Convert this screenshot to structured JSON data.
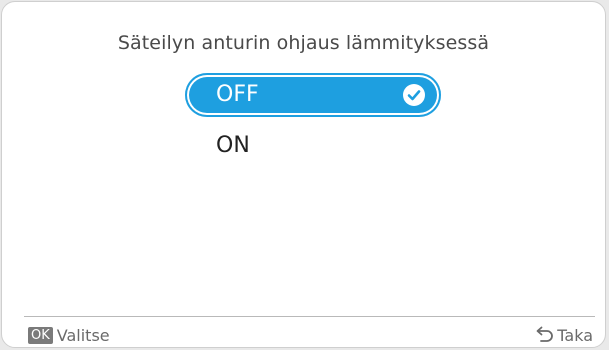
{
  "screen": {
    "title": "Säteilyn anturin ohjaus lämmityksessä"
  },
  "options": [
    {
      "label": "OFF",
      "selected": true,
      "icon": "check-circle-icon"
    },
    {
      "label": "ON",
      "selected": false
    }
  ],
  "footer": {
    "ok_badge": "OK",
    "select_label": "Valitse",
    "back_label": "Taka",
    "back_icon": "back-arrow-icon"
  },
  "colors": {
    "accent": "#1e9fe0",
    "text": "#222222",
    "muted": "#6a6a6a"
  }
}
